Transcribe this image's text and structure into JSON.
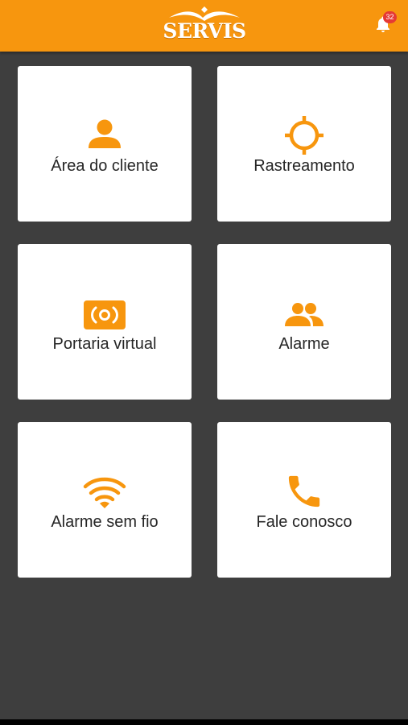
{
  "app_bar": {
    "brand": "SERVIS",
    "notification_count": "32",
    "bell_icon": "bell-icon"
  },
  "tiles": [
    {
      "label": "Área do cliente",
      "icon": "person-icon"
    },
    {
      "label": "Rastreamento",
      "icon": "crosshair-icon"
    },
    {
      "label": "Portaria virtual",
      "icon": "intercom-icon"
    },
    {
      "label": "Alarme",
      "icon": "people-icon"
    },
    {
      "label": "Alarme sem fio",
      "icon": "wifi-icon"
    },
    {
      "label": "Fale conosco",
      "icon": "phone-icon"
    }
  ],
  "colors": {
    "accent": "#f7960e",
    "background": "#3e3e3e",
    "tile": "#ffffff",
    "text": "#262626",
    "badge": "#e53935"
  }
}
